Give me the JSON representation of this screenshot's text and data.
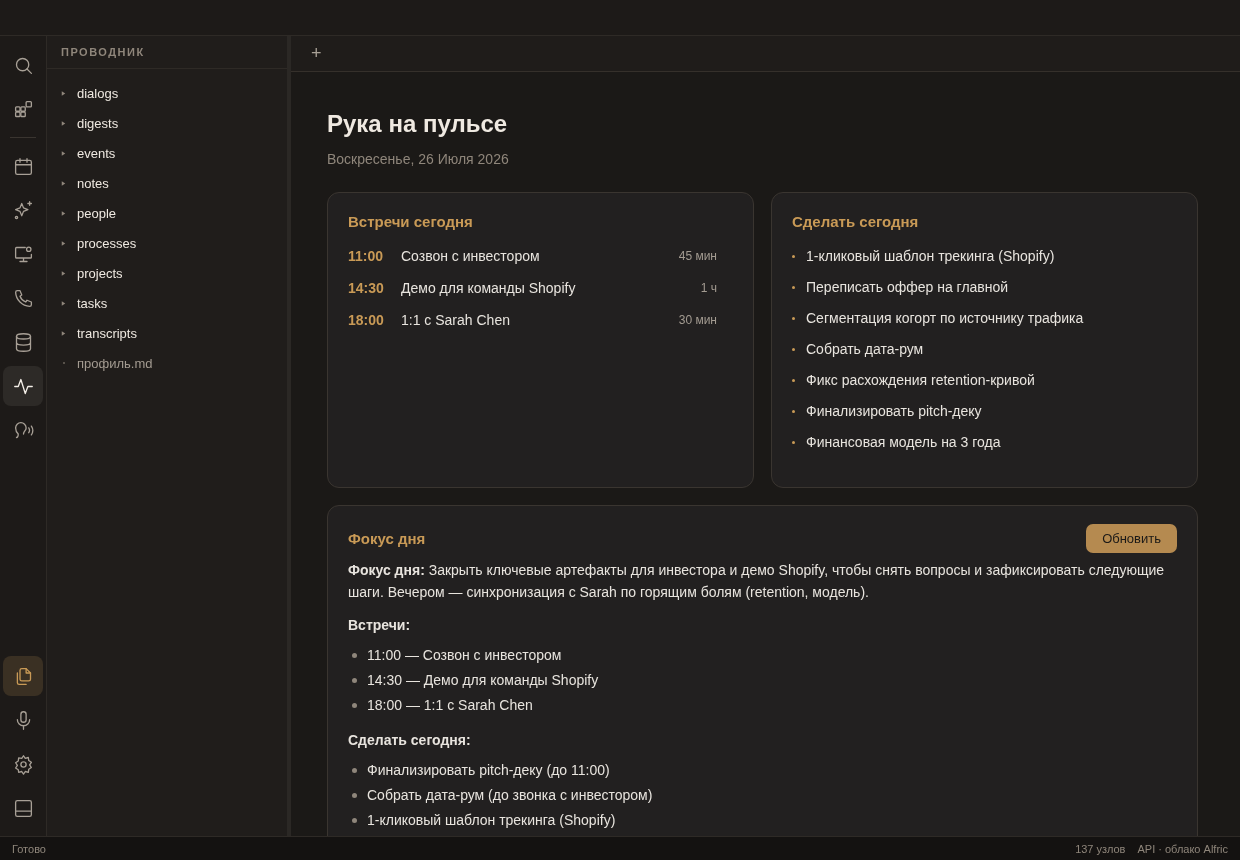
{
  "activity_bar": {
    "top": [
      {
        "kind": "search",
        "selected": false
      },
      {
        "kind": "widgets",
        "selected": false
      }
    ],
    "middle": [
      {
        "kind": "calendar",
        "selected": false
      },
      {
        "kind": "sparkles",
        "selected": false
      },
      {
        "kind": "monitor",
        "selected": false
      },
      {
        "kind": "phone",
        "selected": false
      },
      {
        "kind": "database",
        "selected": false
      },
      {
        "kind": "pulse",
        "selected": true
      },
      {
        "kind": "ear",
        "selected": false
      }
    ],
    "bottom": [
      {
        "kind": "files",
        "selected": true
      },
      {
        "kind": "mic",
        "selected": false
      },
      {
        "kind": "settings",
        "selected": false
      },
      {
        "kind": "panel",
        "selected": false
      }
    ]
  },
  "sidebar": {
    "title": "ПРОВОДНИК",
    "items": [
      {
        "label": "dialogs",
        "kind": "folder"
      },
      {
        "label": "digests",
        "kind": "folder"
      },
      {
        "label": "events",
        "kind": "folder"
      },
      {
        "label": "notes",
        "kind": "folder"
      },
      {
        "label": "people",
        "kind": "folder"
      },
      {
        "label": "processes",
        "kind": "folder"
      },
      {
        "label": "projects",
        "kind": "folder"
      },
      {
        "label": "tasks",
        "kind": "folder"
      },
      {
        "label": "transcripts",
        "kind": "folder"
      },
      {
        "label": "профиль.md",
        "kind": "file"
      }
    ]
  },
  "tab_bar": {
    "new_tab": "+"
  },
  "page": {
    "title": "Рука на пульсе",
    "date": "Воскресенье, 26 Июля 2026",
    "meetings": {
      "title": "Встречи сегодня",
      "items": [
        {
          "time": "11:00",
          "title": "Созвон с инвестором",
          "duration": "45 мин"
        },
        {
          "time": "14:30",
          "title": "Демо для команды Shopify",
          "duration": "1 ч"
        },
        {
          "time": "18:00",
          "title": "1:1 с Sarah Chen",
          "duration": "30 мин"
        }
      ]
    },
    "todo": {
      "title": "Сделать сегодня",
      "items": [
        "1-кликовый шаблон трекинга (Shopify)",
        "Переписать оффер на главной",
        "Сегментация когорт по источнику трафика",
        "Собрать дата-рум",
        "Фикс расхождения retention-кривой",
        "Финализировать pitch-деку",
        "Финансовая модель на 3 года"
      ]
    },
    "focus": {
      "title": "Фокус дня",
      "button": "Обновить",
      "summary": "**Фокус дня:** Закрыть ключевые артефакты для инвестора и демо Shopify, чтобы снять вопросы и зафиксировать следующие шаги. Вечером — синхронизация с Sarah по горящим болям (retention, модель).",
      "sections": [
        {
          "heading": "Встречи:",
          "items": [
            "11:00 — Созвон с инвестором",
            "14:30 — Демо для команды Shopify",
            "18:00 — 1:1 с Sarah Chen"
          ]
        },
        {
          "heading": "Сделать сегодня:",
          "items": [
            "Финализировать pitch-деку (до 11:00)",
            "Собрать дата-рум (до звонка с инвестором)",
            "1-кликовый шаблон трекинга (Shopify)"
          ]
        }
      ]
    }
  },
  "status_bar": {
    "left": "Готово",
    "nodes": "137 узлов",
    "api": "API · облако Alfric"
  }
}
